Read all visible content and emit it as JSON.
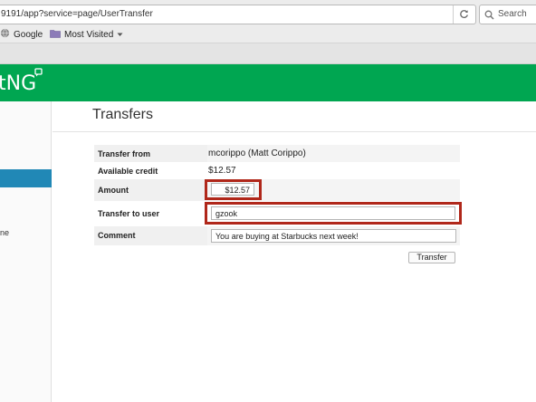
{
  "browser": {
    "url": "9191/app?service=page/UserTransfer",
    "search_placeholder": "Search",
    "bookmarks": [
      {
        "label": "Google"
      },
      {
        "label": "Most Visited"
      }
    ]
  },
  "app": {
    "logo_text": "tNG",
    "brand_color": "#00a651"
  },
  "sidebar": {
    "partial_item_label": "ne"
  },
  "page": {
    "title": "Transfers"
  },
  "form": {
    "transfer_from": {
      "label": "Transfer from",
      "value": "mcorippo (Matt Corippo)"
    },
    "available_credit": {
      "label": "Available credit",
      "value": "$12.57"
    },
    "amount": {
      "label": "Amount",
      "value": "$12.57"
    },
    "transfer_to_user": {
      "label": "Transfer to user",
      "value": "gzook"
    },
    "comment": {
      "label": "Comment",
      "value": "You are buying at Starbucks next week!"
    },
    "submit_label": "Transfer"
  },
  "highlight_color": "#b0271a"
}
